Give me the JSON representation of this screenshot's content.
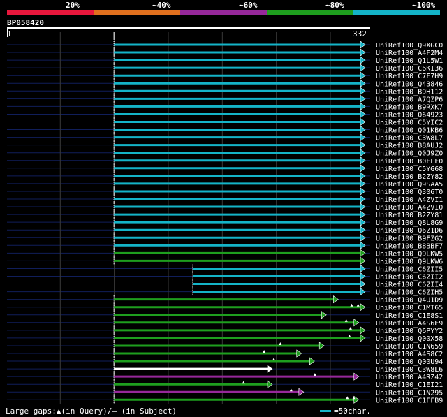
{
  "legend": [
    {
      "label": "20%",
      "color": "#e8173c"
    },
    {
      "label": "~40%",
      "color": "#e0701e"
    },
    {
      "label": "~60%",
      "color": "#96289a"
    },
    {
      "label": "~80%",
      "color": "#1e9e1e"
    },
    {
      "label": "~100%",
      "color": "#14b4c8"
    }
  ],
  "query": {
    "name": "BP058420",
    "start": "1",
    "end": "332"
  },
  "footer": {
    "text": "Large gaps:▲(in Query)/– (in Subject)",
    "scale_label": "=50char."
  },
  "colors": {
    "cyan": "#14b4c8",
    "green": "#1e9e1e",
    "purple": "#96289a",
    "white": "#ffffff",
    "navy": "#101e5a",
    "grid": "#3a3a3a"
  },
  "chart_data": {
    "type": "alignment",
    "query_length": 332,
    "hits": [
      {
        "name": "UniRef100_Q9XGC0",
        "start": 100,
        "end": 332,
        "color": "cyan",
        "query_gaps": []
      },
      {
        "name": "UniRef100_A4F2M4",
        "start": 100,
        "end": 332,
        "color": "cyan",
        "query_gaps": []
      },
      {
        "name": "UniRef100_Q1L5W1",
        "start": 100,
        "end": 332,
        "color": "cyan",
        "query_gaps": []
      },
      {
        "name": "UniRef100_C6KI36",
        "start": 100,
        "end": 332,
        "color": "cyan",
        "query_gaps": []
      },
      {
        "name": "UniRef100_C7F7H9",
        "start": 100,
        "end": 332,
        "color": "cyan",
        "query_gaps": []
      },
      {
        "name": "UniRef100_Q43846",
        "start": 100,
        "end": 332,
        "color": "cyan",
        "query_gaps": []
      },
      {
        "name": "UniRef100_B9H112",
        "start": 100,
        "end": 332,
        "color": "cyan",
        "query_gaps": []
      },
      {
        "name": "UniRef100_A7QZP6",
        "start": 100,
        "end": 332,
        "color": "cyan",
        "query_gaps": []
      },
      {
        "name": "UniRef100_B9RXK7",
        "start": 100,
        "end": 332,
        "color": "cyan",
        "query_gaps": []
      },
      {
        "name": "UniRef100_O64923",
        "start": 100,
        "end": 332,
        "color": "cyan",
        "query_gaps": []
      },
      {
        "name": "UniRef100_C5YIC2",
        "start": 100,
        "end": 332,
        "color": "cyan",
        "query_gaps": []
      },
      {
        "name": "UniRef100_Q01KB6",
        "start": 100,
        "end": 332,
        "color": "cyan",
        "query_gaps": []
      },
      {
        "name": "UniRef100_C3W8L7",
        "start": 100,
        "end": 332,
        "color": "cyan",
        "query_gaps": []
      },
      {
        "name": "UniRef100_B8AUJ2",
        "start": 100,
        "end": 332,
        "color": "cyan",
        "query_gaps": []
      },
      {
        "name": "UniRef100_Q0J9Z0",
        "start": 100,
        "end": 332,
        "color": "cyan",
        "query_gaps": []
      },
      {
        "name": "UniRef100_B0FLF0",
        "start": 100,
        "end": 332,
        "color": "cyan",
        "query_gaps": []
      },
      {
        "name": "UniRef100_C5YG68",
        "start": 100,
        "end": 332,
        "color": "cyan",
        "query_gaps": []
      },
      {
        "name": "UniRef100_B2ZY82",
        "start": 100,
        "end": 332,
        "color": "cyan",
        "query_gaps": []
      },
      {
        "name": "UniRef100_Q9SAA5",
        "start": 100,
        "end": 332,
        "color": "cyan",
        "query_gaps": []
      },
      {
        "name": "UniRef100_Q306T0",
        "start": 100,
        "end": 332,
        "color": "cyan",
        "query_gaps": []
      },
      {
        "name": "UniRef100_A4ZVI1",
        "start": 100,
        "end": 332,
        "color": "cyan",
        "query_gaps": []
      },
      {
        "name": "UniRef100_A4ZVI0",
        "start": 100,
        "end": 332,
        "color": "cyan",
        "query_gaps": []
      },
      {
        "name": "UniRef100_B2ZY81",
        "start": 100,
        "end": 332,
        "color": "cyan",
        "query_gaps": []
      },
      {
        "name": "UniRef100_Q8L8G9",
        "start": 100,
        "end": 332,
        "color": "cyan",
        "query_gaps": []
      },
      {
        "name": "UniRef100_Q6Z1D6",
        "start": 100,
        "end": 332,
        "color": "cyan",
        "query_gaps": []
      },
      {
        "name": "UniRef100_B9FZG2",
        "start": 100,
        "end": 332,
        "color": "cyan",
        "query_gaps": []
      },
      {
        "name": "UniRef100_B8BBF7",
        "start": 100,
        "end": 332,
        "color": "cyan",
        "query_gaps": []
      },
      {
        "name": "UniRef100_Q9LKW5",
        "start": 100,
        "end": 332,
        "color": "green",
        "query_gaps": []
      },
      {
        "name": "UniRef100_Q9LKW6",
        "start": 100,
        "end": 332,
        "color": "green",
        "query_gaps": []
      },
      {
        "name": "UniRef100_C6ZII5",
        "start": 173,
        "end": 332,
        "color": "cyan",
        "query_gaps": []
      },
      {
        "name": "UniRef100_C6ZII2",
        "start": 173,
        "end": 332,
        "color": "cyan",
        "query_gaps": []
      },
      {
        "name": "UniRef100_C6ZII4",
        "start": 173,
        "end": 332,
        "color": "cyan",
        "query_gaps": []
      },
      {
        "name": "UniRef100_C6ZIH5",
        "start": 173,
        "end": 332,
        "color": "cyan",
        "query_gaps": []
      },
      {
        "name": "UniRef100_Q4U1D9",
        "start": 100,
        "end": 307,
        "color": "green",
        "query_gaps": []
      },
      {
        "name": "UniRef100_C1MT65",
        "start": 100,
        "end": 332,
        "color": "green",
        "query_gaps": [
          320,
          326
        ]
      },
      {
        "name": "UniRef100_C1E8S1",
        "start": 100,
        "end": 296,
        "color": "green",
        "query_gaps": []
      },
      {
        "name": "UniRef100_A4S6E9",
        "start": 100,
        "end": 326,
        "color": "green",
        "query_gaps": [
          315
        ]
      },
      {
        "name": "UniRef100_Q6PYY2",
        "start": 100,
        "end": 332,
        "color": "green",
        "query_gaps": [
          319
        ]
      },
      {
        "name": "UniRef100_Q00X58",
        "start": 100,
        "end": 332,
        "color": "green",
        "query_gaps": [
          318
        ]
      },
      {
        "name": "UniRef100_C1N659",
        "start": 100,
        "end": 294,
        "color": "green",
        "query_gaps": [
          254
        ]
      },
      {
        "name": "UniRef100_A4S8C2",
        "start": 100,
        "end": 273,
        "color": "green",
        "query_gaps": [
          239
        ]
      },
      {
        "name": "UniRef100_Q00U94",
        "start": 100,
        "end": 285,
        "color": "green",
        "query_gaps": [
          248
        ]
      },
      {
        "name": "UniRef100_C3W8L6",
        "start": 100,
        "end": 246,
        "color": "white",
        "query_gaps": []
      },
      {
        "name": "UniRef100_A4RZ42",
        "start": 100,
        "end": 326,
        "color": "purple",
        "query_gaps": [
          286
        ]
      },
      {
        "name": "UniRef100_C1EI21",
        "start": 100,
        "end": 246,
        "color": "green",
        "query_gaps": [
          220
        ]
      },
      {
        "name": "UniRef100_C1N295",
        "start": 100,
        "end": 275,
        "color": "purple",
        "query_gaps": [
          264
        ]
      },
      {
        "name": "UniRef100_C1FFB9",
        "start": 100,
        "end": 326,
        "color": "green",
        "query_gaps": [
          316,
          322
        ]
      }
    ]
  }
}
